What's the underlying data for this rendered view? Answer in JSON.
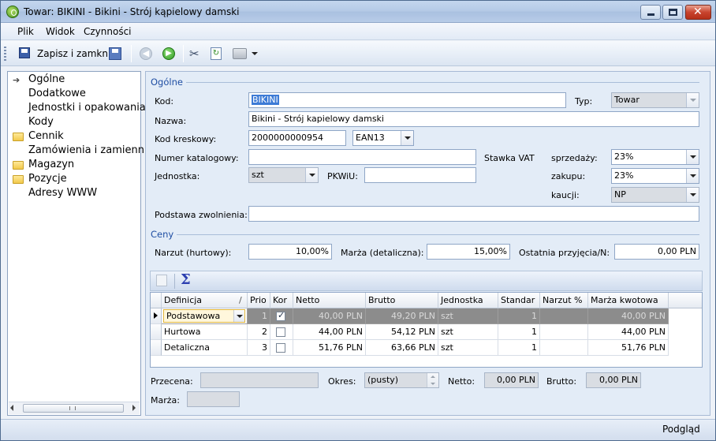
{
  "window": {
    "title": "Towar: BIKINI - Bikini - Strój kąpielowy damski"
  },
  "menu": [
    "Plik",
    "Widok",
    "Czynności"
  ],
  "toolbar": {
    "save_close_label": "Zapisz i zamknij"
  },
  "tree": {
    "items": [
      {
        "label": "Ogólne",
        "icon": "arrow-icon"
      },
      {
        "label": "Dodatkowe",
        "icon": ""
      },
      {
        "label": "Jednostki i opakowania",
        "icon": ""
      },
      {
        "label": "Kody",
        "icon": ""
      },
      {
        "label": "Cennik",
        "icon": "folder-icon"
      },
      {
        "label": "Zamówienia i zamiennik",
        "icon": ""
      },
      {
        "label": "Magazyn",
        "icon": "folder-icon"
      },
      {
        "label": "Pozycje",
        "icon": "folder-icon"
      },
      {
        "label": "Adresy WWW",
        "icon": ""
      }
    ]
  },
  "general": {
    "section_title": "Ogólne",
    "kod_label": "Kod:",
    "kod_value": "BIKINI",
    "typ_label": "Typ:",
    "typ_value": "Towar",
    "nazwa_label": "Nazwa:",
    "nazwa_value": "Bikini - Strój kapielowy damski",
    "kod_kreskowy_label": "Kod kreskowy:",
    "kod_kreskowy_value": "2000000000954",
    "ean_value": "EAN13",
    "numer_katalogowy_label": "Numer katalogowy:",
    "numer_katalogowy_value": "",
    "stawka_vat_label": "Stawka VAT",
    "sprzedazy_label": "sprzedaży:",
    "sprzedazy_value": "23%",
    "zakupu_label": "zakupu:",
    "zakupu_value": "23%",
    "kaucji_label": "kaucji:",
    "kaucji_value": "NP",
    "jednostka_label": "Jednostka:",
    "jednostka_value": "szt",
    "pkwiu_label": "PKWiU:",
    "pkwiu_value": "",
    "podstawa_label": "Podstawa zwolnienia:",
    "podstawa_value": ""
  },
  "ceny": {
    "section_title": "Ceny",
    "narzut_label": "Narzut (hurtowy):",
    "narzut_value": "10,00%",
    "marza_label": "Marża (detaliczna):",
    "marza_value": "15,00%",
    "ostatnia_label": "Ostatnia przyjęcia/N:",
    "ostatnia_value": "0,00 PLN"
  },
  "grid": {
    "columns": [
      "Definicja",
      "Prio",
      "Kor",
      "Netto",
      "Brutto",
      "Jednostka",
      "Standar",
      "Narzut %",
      "Marża kwotowa"
    ],
    "rows": [
      {
        "definicja": "Podstawowa",
        "prio": "1",
        "kor": true,
        "netto": "40,00 PLN",
        "brutto": "49,20 PLN",
        "jednostka": "szt",
        "standard": "1",
        "narzut": "",
        "marza": "40,00 PLN"
      },
      {
        "definicja": "Hurtowa",
        "prio": "2",
        "kor": false,
        "netto": "44,00 PLN",
        "brutto": "54,12 PLN",
        "jednostka": "szt",
        "standard": "1",
        "narzut": "",
        "marza": "44,00 PLN"
      },
      {
        "definicja": "Detaliczna",
        "prio": "3",
        "kor": false,
        "netto": "51,76 PLN",
        "brutto": "63,66 PLN",
        "jednostka": "szt",
        "standard": "1",
        "narzut": "",
        "marza": "51,76 PLN"
      }
    ]
  },
  "bottom": {
    "przecena_label": "Przecena:",
    "przecena_value": "",
    "okres_label": "Okres:",
    "okres_value": "(pusty)",
    "netto_label": "Netto:",
    "netto_value": "0,00 PLN",
    "brutto_label": "Brutto:",
    "brutto_value": "0,00 PLN",
    "marza_label": "Marża:",
    "marza_value": ""
  },
  "status": {
    "right_text": "Podgląd"
  }
}
